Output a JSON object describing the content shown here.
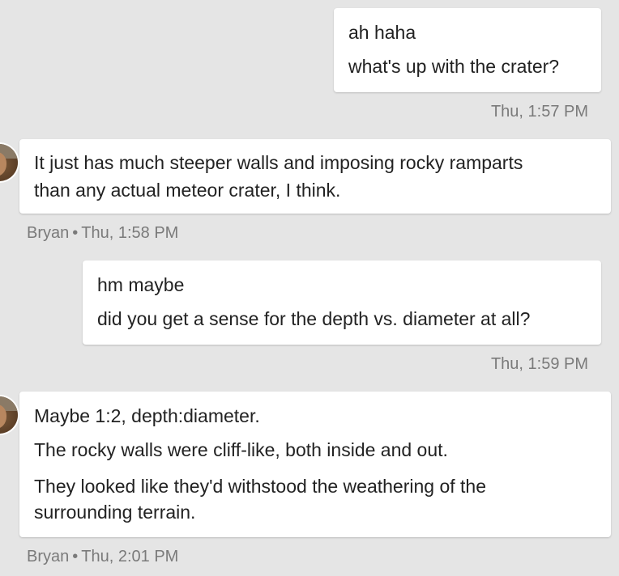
{
  "messages": [
    {
      "side": "right",
      "lines": [
        "ah haha",
        "what's up with the crater?"
      ],
      "meta": "Thu, 1:57 PM"
    },
    {
      "side": "left",
      "sender": "Bryan",
      "lines": [
        "It just has much steeper walls and imposing rocky ramparts",
        "than any actual meteor crater, I think."
      ],
      "time": "Thu, 1:58 PM"
    },
    {
      "side": "right",
      "lines": [
        "hm maybe",
        "did you get a sense for the depth vs. diameter at all?"
      ],
      "meta": "Thu, 1:59 PM"
    },
    {
      "side": "left",
      "sender": "Bryan",
      "lines": [
        "Maybe 1:2, depth:diameter.",
        "The rocky walls were cliff-like, both inside and out.",
        "They looked like they'd withstood the weathering of the",
        "surrounding terrain."
      ],
      "time": "Thu, 2:01 PM"
    }
  ],
  "separator": "•",
  "colors": {
    "background": "#e5e5e5",
    "bubble": "#ffffff",
    "text": "#222222",
    "meta": "#7a7a7a"
  }
}
